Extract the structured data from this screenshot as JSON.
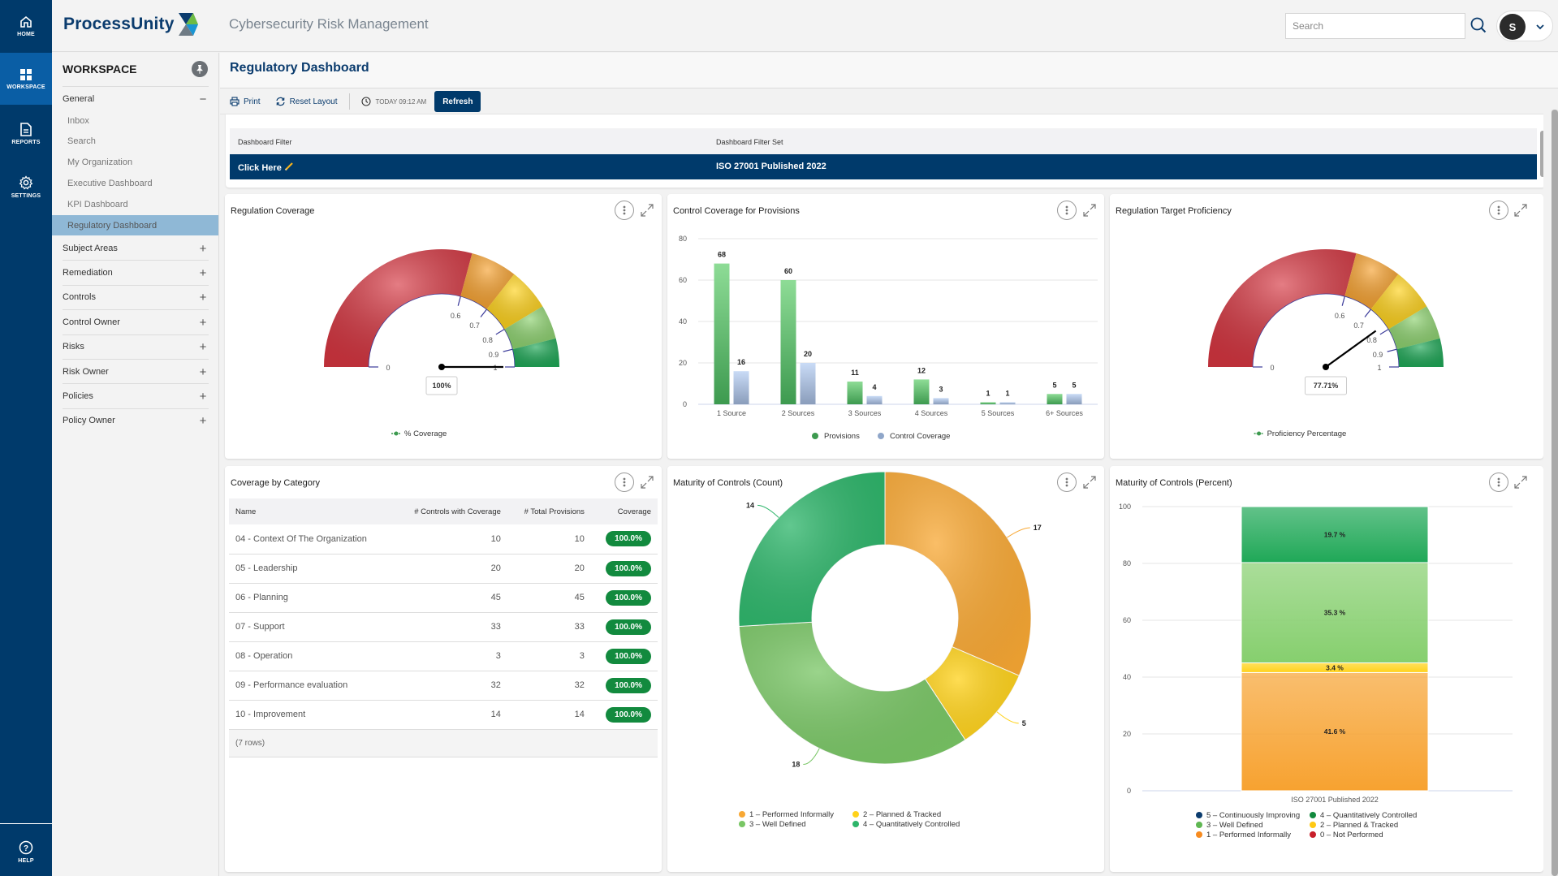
{
  "rail": {
    "home": "HOME",
    "workspace": "WORKSPACE",
    "reports": "REPORTS",
    "settings": "SETTINGS",
    "help": "HELP"
  },
  "header": {
    "logo": "ProcessUnity",
    "app_title": "Cybersecurity Risk Management",
    "search_placeholder": "Search",
    "user_initial": "S"
  },
  "workspace": {
    "title": "WORKSPACE",
    "sections": [
      {
        "label": "General",
        "expanded": true,
        "sign": "−",
        "items": [
          "Inbox",
          "Search",
          "My Organization",
          "Executive Dashboard",
          "KPI Dashboard",
          "Regulatory Dashboard"
        ],
        "active_item": "Regulatory Dashboard"
      },
      {
        "label": "Subject Areas",
        "sign": "+"
      },
      {
        "label": "Remediation",
        "sign": "+"
      },
      {
        "label": "Controls",
        "sign": "+"
      },
      {
        "label": "Control Owner",
        "sign": "+"
      },
      {
        "label": "Risks",
        "sign": "+"
      },
      {
        "label": "Risk Owner",
        "sign": "+"
      },
      {
        "label": "Policies",
        "sign": "+"
      },
      {
        "label": "Policy Owner",
        "sign": "+"
      }
    ]
  },
  "page": {
    "title": "Regulatory Dashboard",
    "toolbar": {
      "print": "Print",
      "reset_layout": "Reset Layout",
      "timestamp": "TODAY 09:12 AM",
      "refresh": "Refresh"
    }
  },
  "filter": {
    "col1_header": "Dashboard Filter",
    "col2_header": "Dashboard Filter Set",
    "col1_value": "Click Here",
    "col2_value": "ISO 27001 Published 2022"
  },
  "colors": {
    "brand": "#003a6b",
    "accent": "#0a5ea5",
    "badge_green": "#128a3e",
    "red": "#c8202b",
    "orange": "#f7a230",
    "yellow": "#ffd21a",
    "light_green": "#7cc96a",
    "green": "#1fa857"
  },
  "cards": {
    "regulation_coverage": {
      "title": "Regulation Coverage"
    },
    "control_coverage": {
      "title": "Control Coverage for Provisions"
    },
    "target_proficiency": {
      "title": "Regulation Target Proficiency"
    },
    "coverage_by_category": {
      "title": "Coverage by Category",
      "columns": [
        "Name",
        "# Controls with Coverage",
        "# Total Provisions",
        "Coverage"
      ],
      "rows": [
        {
          "name": "04 - Context Of The Organization",
          "controls": "10",
          "provisions": "10",
          "coverage": "100.0%"
        },
        {
          "name": "05 - Leadership",
          "controls": "20",
          "provisions": "20",
          "coverage": "100.0%"
        },
        {
          "name": "06 - Planning",
          "controls": "45",
          "provisions": "45",
          "coverage": "100.0%"
        },
        {
          "name": "07 - Support",
          "controls": "33",
          "provisions": "33",
          "coverage": "100.0%"
        },
        {
          "name": "08 - Operation",
          "controls": "3",
          "provisions": "3",
          "coverage": "100.0%"
        },
        {
          "name": "09 - Performance evaluation",
          "controls": "32",
          "provisions": "32",
          "coverage": "100.0%"
        },
        {
          "name": "10 - Improvement",
          "controls": "14",
          "provisions": "14",
          "coverage": "100.0%"
        }
      ],
      "footer": "(7 rows)"
    },
    "maturity_count": {
      "title": "Maturity of Controls (Count)"
    },
    "maturity_percent": {
      "title": "Maturity of Controls (Percent)"
    }
  },
  "chart_data": [
    {
      "id": "regulation_coverage",
      "type": "gauge",
      "title": "Regulation Coverage",
      "value": 1.0,
      "value_label": "100%",
      "ticks": [
        0,
        0.6,
        0.7,
        0.8,
        0.9,
        1
      ],
      "tick_labels": [
        "0",
        "0.6",
        "0.7",
        "0.8",
        "0.9",
        "1"
      ],
      "bands": [
        {
          "from": 0,
          "to": 0.6,
          "color": "#d63641"
        },
        {
          "from": 0.6,
          "to": 0.7,
          "color": "#f7a230"
        },
        {
          "from": 0.7,
          "to": 0.8,
          "color": "#ffd21a"
        },
        {
          "from": 0.8,
          "to": 0.9,
          "color": "#8dd26f"
        },
        {
          "from": 0.9,
          "to": 1,
          "color": "#1fa857"
        }
      ],
      "legend": "% Coverage",
      "legend_position": "bottom"
    },
    {
      "id": "control_coverage",
      "type": "bar",
      "title": "Control Coverage for Provisions",
      "categories": [
        "1 Source",
        "2 Sources",
        "3 Sources",
        "4 Sources",
        "5 Sources",
        "6+ Sources"
      ],
      "series": [
        {
          "name": "Provisions",
          "values": [
            68,
            60,
            11,
            12,
            1,
            5
          ],
          "color": "#3d9a4f"
        },
        {
          "name": "Control Coverage",
          "values": [
            16,
            20,
            4,
            3,
            1,
            5
          ],
          "color": "#8fa6c9"
        }
      ],
      "ylim": [
        0,
        80
      ],
      "yticks": [
        0,
        20,
        40,
        60,
        80
      ],
      "grid": true,
      "legend_position": "bottom"
    },
    {
      "id": "target_proficiency",
      "type": "gauge",
      "title": "Regulation Target Proficiency",
      "value": 0.7771,
      "value_label": "77.71%",
      "ticks": [
        0,
        0.6,
        0.7,
        0.8,
        0.9,
        1
      ],
      "tick_labels": [
        "0",
        "0.6",
        "0.7",
        "0.8",
        "0.9",
        "1"
      ],
      "bands": [
        {
          "from": 0,
          "to": 0.6,
          "color": "#d63641"
        },
        {
          "from": 0.6,
          "to": 0.7,
          "color": "#f7a230"
        },
        {
          "from": 0.7,
          "to": 0.8,
          "color": "#ffd21a"
        },
        {
          "from": 0.8,
          "to": 0.9,
          "color": "#8dd26f"
        },
        {
          "from": 0.9,
          "to": 1,
          "color": "#1fa857"
        }
      ],
      "legend": "Proficiency Percentage",
      "legend_position": "bottom"
    },
    {
      "id": "maturity_count",
      "type": "pie",
      "donut": true,
      "title": "Maturity of Controls (Count)",
      "slices": [
        {
          "label": "1 – Performed Informally",
          "value": 17,
          "color": "#f8a834"
        },
        {
          "label": "2 – Planned & Tracked",
          "value": 5,
          "color": "#ffd21a"
        },
        {
          "label": "3 – Well Defined",
          "value": 18,
          "color": "#79c665"
        },
        {
          "label": "4 – Quantitatively Controlled",
          "value": 14,
          "color": "#2db56a"
        }
      ],
      "legend_position": "bottom"
    },
    {
      "id": "maturity_percent",
      "type": "bar",
      "stacked": true,
      "title": "Maturity of Controls (Percent)",
      "categories": [
        "ISO 27001 Published 2022"
      ],
      "series": [
        {
          "name": "1 – Performed Informally",
          "values": [
            41.6
          ],
          "label": "41.6 %",
          "color": "#f7a230"
        },
        {
          "name": "2 – Planned & Tracked",
          "values": [
            3.4
          ],
          "label": "3.4 %",
          "color": "#ffd21a"
        },
        {
          "name": "3 – Well Defined",
          "values": [
            35.3
          ],
          "label": "35.3 %",
          "color": "#86cf6e"
        },
        {
          "name": "4 – Quantitatively Controlled",
          "values": [
            19.7
          ],
          "label": "19.7 %",
          "color": "#1fa857"
        }
      ],
      "legend": [
        {
          "name": "5 – Continuously Improving",
          "color": "#0b3c6e"
        },
        {
          "name": "4 – Quantitatively Controlled",
          "color": "#128a3e"
        },
        {
          "name": "3 – Well Defined",
          "color": "#5fb752"
        },
        {
          "name": "2 – Planned & Tracked",
          "color": "#ffc914"
        },
        {
          "name": "1 – Performed Informally",
          "color": "#f78b1f"
        },
        {
          "name": "0 – Not Performed",
          "color": "#c8202b"
        }
      ],
      "ylim": [
        0,
        100
      ],
      "yticks": [
        0,
        20,
        40,
        60,
        80,
        100
      ],
      "grid": true,
      "legend_position": "bottom"
    }
  ]
}
